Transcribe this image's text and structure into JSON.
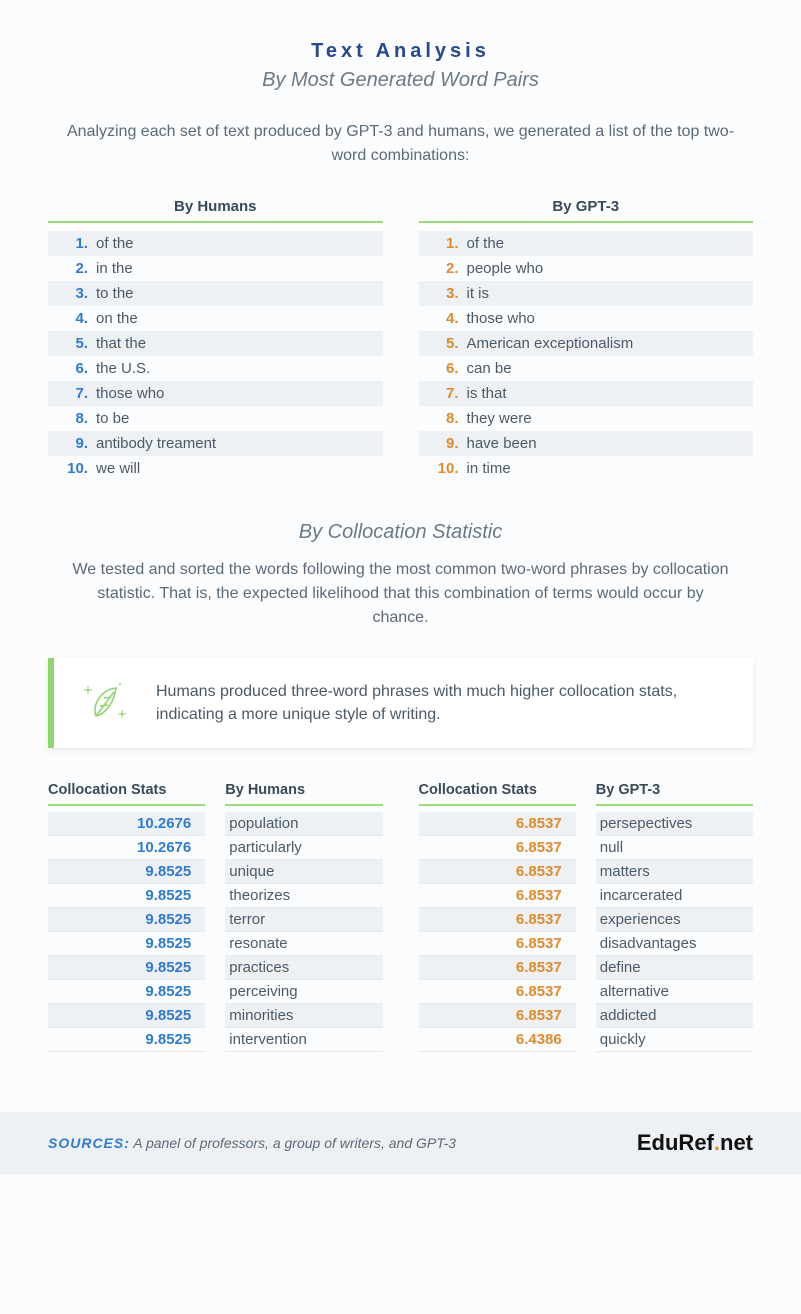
{
  "header": {
    "title": "Text Analysis",
    "subtitle": "By Most Generated Word Pairs",
    "intro": "Analyzing each set of text produced by GPT-3 and humans, we generated a list of the top two-word combinations:"
  },
  "wordPairs": {
    "humans": {
      "heading": "By Humans",
      "items": [
        "of the",
        "in the",
        "to the",
        "on the",
        "that the",
        "the U.S.",
        "those who",
        "to be",
        "antibody treament",
        "we will"
      ]
    },
    "gpt3": {
      "heading": "By GPT-3",
      "items": [
        "of the",
        "people who",
        "it is",
        "those who",
        "American exceptionalism",
        "can be",
        "is that",
        "they were",
        "have been",
        "in time"
      ]
    }
  },
  "collocationSection": {
    "subtitle": "By Collocation Statistic",
    "desc": "We tested and sorted the words following the most common two-word phrases by collocation statistic. That is, the expected likelihood that this combination of terms would occur by chance.",
    "callout": "Humans produced three-word phrases with much higher collocation stats, indicating a more unique style of writing."
  },
  "collocHeads": {
    "stats": "Collocation Stats",
    "humans": "By Humans",
    "gpt3": "By GPT-3"
  },
  "collocHumans": [
    {
      "stat": "10.2676",
      "word": "population"
    },
    {
      "stat": "10.2676",
      "word": "particularly"
    },
    {
      "stat": "9.8525",
      "word": "unique"
    },
    {
      "stat": "9.8525",
      "word": "theorizes"
    },
    {
      "stat": "9.8525",
      "word": "terror"
    },
    {
      "stat": "9.8525",
      "word": "resonate"
    },
    {
      "stat": "9.8525",
      "word": "practices"
    },
    {
      "stat": "9.8525",
      "word": "perceiving"
    },
    {
      "stat": "9.8525",
      "word": "minorities"
    },
    {
      "stat": "9.8525",
      "word": "intervention"
    }
  ],
  "collocGpt3": [
    {
      "stat": "6.8537",
      "word": "persepectives"
    },
    {
      "stat": "6.8537",
      "word": "null"
    },
    {
      "stat": "6.8537",
      "word": "matters"
    },
    {
      "stat": "6.8537",
      "word": "incarcerated"
    },
    {
      "stat": "6.8537",
      "word": "experiences"
    },
    {
      "stat": "6.8537",
      "word": "disadvantages"
    },
    {
      "stat": "6.8537",
      "word": "define"
    },
    {
      "stat": "6.8537",
      "word": "alternative"
    },
    {
      "stat": "6.8537",
      "word": "addicted"
    },
    {
      "stat": "6.4386",
      "word": "quickly"
    }
  ],
  "footer": {
    "sourcesLabel": "SOURCES:",
    "sourcesText": " A panel of professors, a group of writers, and GPT-3",
    "brandA": "EduRef",
    "brandDot": ".",
    "brandB": "net"
  }
}
